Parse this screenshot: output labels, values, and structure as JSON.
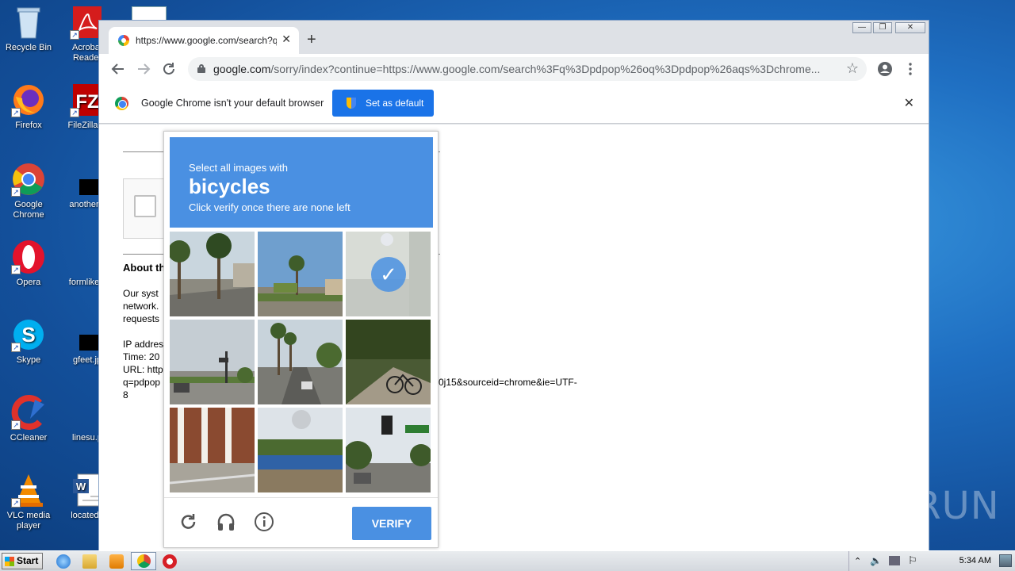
{
  "desktop": {
    "icons": [
      {
        "label": "Recycle Bin"
      },
      {
        "label": "Acrobat Reader"
      },
      {
        "label": "Firefox"
      },
      {
        "label": "FileZilla C"
      },
      {
        "label": "Google Chrome"
      },
      {
        "label": "anotherw"
      },
      {
        "label": "Opera"
      },
      {
        "label": "formlikely"
      },
      {
        "label": "Skype"
      },
      {
        "label": "gfeet.jp"
      },
      {
        "label": "CCleaner"
      },
      {
        "label": "linesu.p"
      },
      {
        "label": "VLC media player"
      },
      {
        "label": "locatede"
      }
    ],
    "watermark": "ANY RUN"
  },
  "browser": {
    "tab_title": "https://www.google.com/search?q=",
    "url_host": "google.com",
    "url_rest": "/sorry/index?continue=https://www.google.com/search%3Fq%3Dpdpop%26oq%3Dpdpop%26aqs%3Dchrome...",
    "infobar_message": "Google Chrome isn't your default browser",
    "set_default_label": "Set as default"
  },
  "page": {
    "about_heading": "About th",
    "para1_line1": "Our syst",
    "para1_line2": "network.",
    "para1_line3": "requests",
    "ip_line": "IP addres",
    "time_line": "Time: 20",
    "url_line": "URL: http",
    "url_line2": "q=pdpop",
    "url_tail": "0j15&sourceid=chrome&ie=UTF-",
    "url_tail2": "8"
  },
  "captcha": {
    "select_text": "Select all images with",
    "target": "bicycles",
    "instruction": "Click verify once there are none left",
    "verify_label": "VERIFY",
    "tiles": [
      {
        "selected": false
      },
      {
        "selected": false
      },
      {
        "selected": true
      },
      {
        "selected": false
      },
      {
        "selected": false
      },
      {
        "selected": false
      },
      {
        "selected": false
      },
      {
        "selected": false
      },
      {
        "selected": false
      }
    ]
  },
  "taskbar": {
    "start_label": "Start",
    "clock": "5:34 AM"
  }
}
